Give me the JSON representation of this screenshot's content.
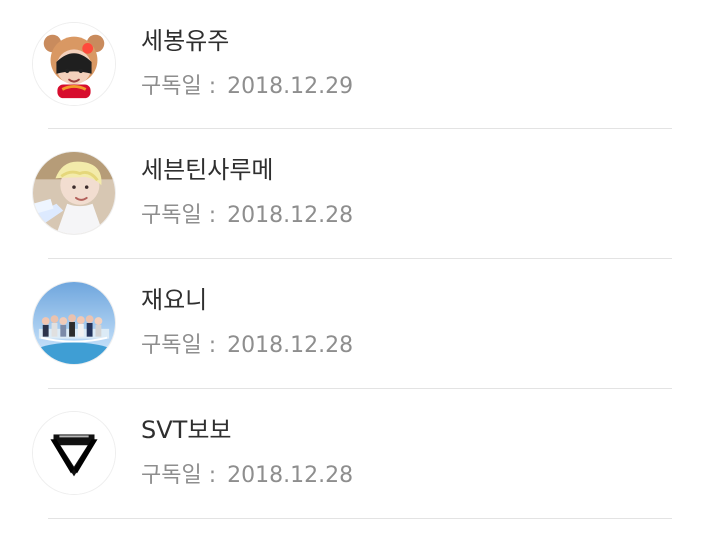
{
  "subscriptions": [
    {
      "name": "세봉유주",
      "subscribed_label": "구독일 :",
      "subscribed_date": "2018.12.29",
      "avatar_icon": "bear-hat-cartoon-avatar"
    },
    {
      "name": "세븐틴사루메",
      "subscribed_label": "구독일 :",
      "subscribed_date": "2018.12.28",
      "avatar_icon": "blonde-person-photo-avatar"
    },
    {
      "name": "재요니",
      "subscribed_label": "구독일 :",
      "subscribed_date": "2018.12.28",
      "avatar_icon": "group-photo-avatar"
    },
    {
      "name": "SVT보보",
      "subscribed_label": "구독일 :",
      "subscribed_date": "2018.12.28",
      "avatar_icon": "black-triangle-logo-avatar"
    }
  ],
  "colors": {
    "name_text": "#2f2f2f",
    "meta_text": "#8e8e8e",
    "divider": "#e3e3e3",
    "background": "#ffffff"
  }
}
